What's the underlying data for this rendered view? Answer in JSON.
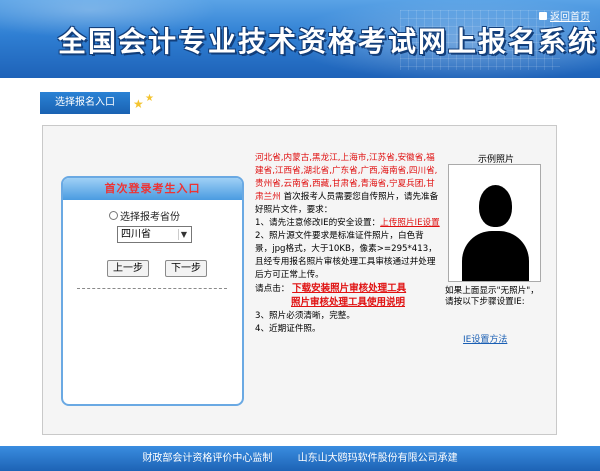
{
  "header": {
    "title": "全国会计专业技术资格考试网上报名系统",
    "home_link": "返回首页"
  },
  "tab": {
    "label": "选择报名入口"
  },
  "login_box": {
    "title": "首次登录考生入口",
    "province_radio_label": "选择报考省份",
    "province_selected": "四川省",
    "prev_button": "上一步",
    "next_button": "下一步"
  },
  "instructions": {
    "provinces": "河北省,内蒙古,黑龙江,上海市,江苏省,安徽省,福建省,江西省,湖北省,广东省,广西,海南省,四川省,贵州省,云南省,西藏,甘肃省,青海省,宁夏兵团,甘肃兰州",
    "provinces_suffix": "首次报考人员需要您自传照片，请先准备好照片文件，要求：",
    "item1_text": "1、请先注意修改IE的安全设置：",
    "item1_link": "上传照片IE设置",
    "item2_text": "2、照片源文件要求是标准证件照片，白色背景，jpg格式，大于10KB，像素>=295*413，且经专用报名照片审核处理工具审核通过并处理后方可正常上传。",
    "click_prefix": "请点击：",
    "download_link": "下载安装照片审核处理工具",
    "manual_link": "照片审核处理工具使用说明",
    "item3_text": "3、照片必须清晰，完整。",
    "item4_text": "4、近期证件照。"
  },
  "photo": {
    "title": "示例照片",
    "note": "如果上面显示\"无照片\"，请按以下步骤设置IE:",
    "ie_link": "IE设置方法"
  },
  "footer": {
    "left": "财政部会计资格评价中心监制",
    "right": "山东山大鸥玛软件股份有限公司承建"
  }
}
